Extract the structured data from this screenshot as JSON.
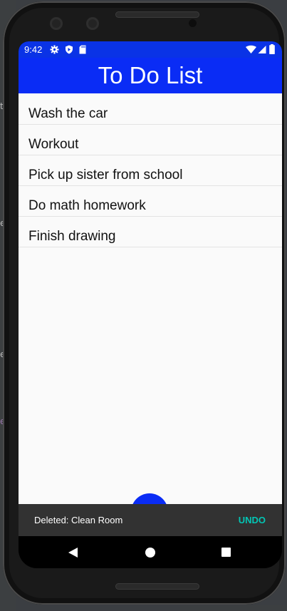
{
  "statusbar": {
    "time": "9:42"
  },
  "appbar": {
    "title": "To Do List"
  },
  "todos": [
    {
      "label": "Wash the car"
    },
    {
      "label": "Workout"
    },
    {
      "label": "Pick up sister from school"
    },
    {
      "label": "Do math homework"
    },
    {
      "label": "Finish drawing"
    }
  ],
  "snackbar": {
    "message": "Deleted: Clean Room",
    "action": "UNDO"
  },
  "colors": {
    "primary": "#0a2cf5",
    "accent": "#03c5b4",
    "snackbar": "#323232"
  },
  "icons": {
    "status": [
      "settings-icon",
      "shield-icon",
      "sd-card-icon",
      "wifi-icon",
      "signal-icon",
      "battery-icon"
    ],
    "nav": [
      "back-icon",
      "home-icon",
      "recents-icon"
    ]
  }
}
